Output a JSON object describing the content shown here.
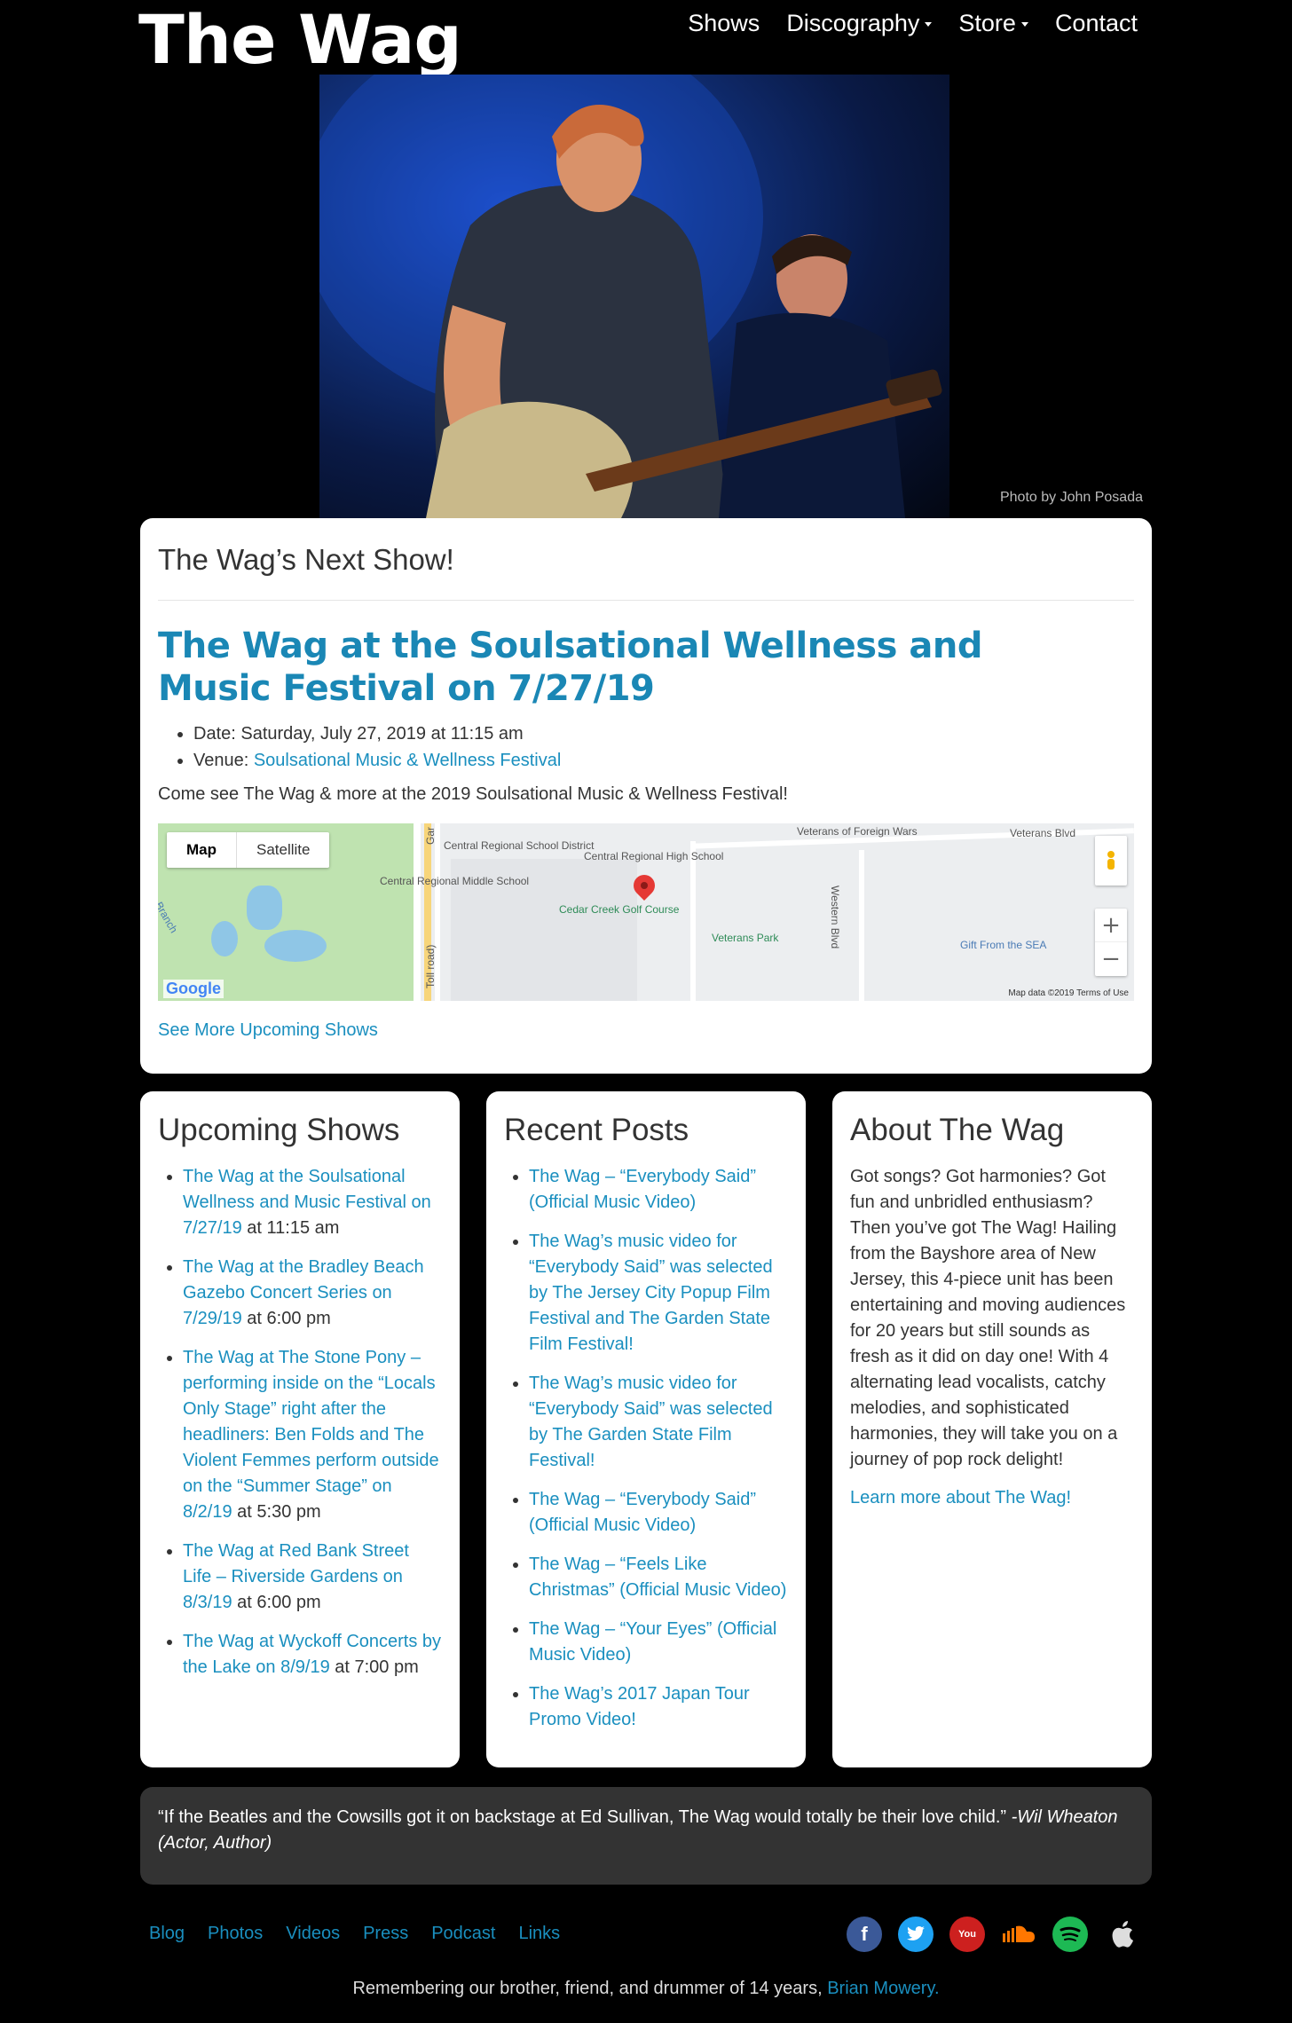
{
  "header": {
    "logo": "The Wag",
    "nav": [
      {
        "label": "Shows",
        "has_dropdown": false
      },
      {
        "label": "Discography",
        "has_dropdown": true
      },
      {
        "label": "Store",
        "has_dropdown": true
      },
      {
        "label": "Contact",
        "has_dropdown": false
      }
    ]
  },
  "hero": {
    "photo_credit": "Photo by John Posada"
  },
  "next_show": {
    "heading": "The Wag’s Next Show!",
    "event_title": "The Wag at the Soulsational Wellness and Music Festival on 7/27/19",
    "date_text": "Date: Saturday, July 27, 2019 at 11:15 am",
    "venue_label": "Venue: ",
    "venue_link": "Soulsational Music & Wellness Festival",
    "description": "Come see The Wag & more at the 2019 Soulsational Music & Wellness Festival!",
    "see_more": "See More Upcoming Shows",
    "map": {
      "toggle_map": "Map",
      "toggle_satellite": "Satellite",
      "labels": {
        "veterans_foreign_wars": "Veterans of Foreign Wars",
        "veterans_blvd": "Veterans Blvd",
        "central_regional_school_district": "Central Regional School District",
        "central_regional_high_school": "Central Regional High School",
        "central_regional_middle_school": "Central Regional Middle School",
        "cedar_creek": "Cedar Creek Golf Course",
        "veterans_park": "Veterans Park",
        "western_blvd": "Western Blvd",
        "gift_from_the_sea": "Gift From the SEA",
        "branch": "Branch",
        "toll_road": "Toll road)",
        "garden": "Gar"
      },
      "google_logo": "Google",
      "attribution": "Map data ©2019   Terms of Use"
    }
  },
  "upcoming_shows": {
    "heading": "Upcoming Shows",
    "items": [
      {
        "link": "The Wag at the Soulsational Wellness and Music Festival on 7/27/19",
        "time": " at 11:15 am"
      },
      {
        "link": "The Wag at the Bradley Beach Gazebo Concert Series on 7/29/19",
        "time": " at 6:00 pm"
      },
      {
        "link": "The Wag at The Stone Pony – performing inside on the “Locals Only Stage” right after the headliners: Ben Folds and The Violent Femmes perform outside on the “Summer Stage” on 8/2/19",
        "time": " at 5:30 pm"
      },
      {
        "link": "The Wag at Red Bank Street Life – Riverside Gardens on 8/3/19",
        "time": " at 6:00 pm"
      },
      {
        "link": "The Wag at Wyckoff Concerts by the Lake on 8/9/19",
        "time": " at 7:00 pm"
      }
    ]
  },
  "recent_posts": {
    "heading": "Recent Posts",
    "items": [
      "The Wag – “Everybody Said” (Official Music Video)",
      "The Wag’s music video for “Everybody Said” was selected by The Jersey City Popup Film Festival and The Garden State Film Festival!",
      "The Wag’s music video for “Everybody Said” was selected by The Garden State Film Festival!",
      "The Wag – “Everybody Said” (Official Music Video)",
      "The Wag – “Feels Like Christmas” (Official Music Video)",
      "The Wag – “Your Eyes” (Official Music Video)",
      "The Wag’s 2017 Japan Tour Promo Video!"
    ]
  },
  "about": {
    "heading": "About The Wag",
    "body": "Got songs? Got harmonies? Got fun and unbridled enthusiasm? Then you’ve got The Wag! Hailing from the Bayshore area of New Jersey, this 4-piece unit has been entertaining and moving audiences for 20 years but still sounds as fresh as it did on day one! With 4 alternating lead vocalists, catchy melodies, and sophisticated harmonies, they will take you on a journey of pop rock delight!",
    "link": "Learn more about The Wag!"
  },
  "quote": {
    "text": "“If the Beatles and the Cowsills got it on backstage at Ed Sullivan, The Wag would totally be their love child.”",
    "attribution": " -Wil Wheaton (Actor, Author)"
  },
  "footer": {
    "links": [
      "Blog",
      "Photos",
      "Videos",
      "Press",
      "Podcast",
      "Links"
    ],
    "socials": [
      {
        "name": "facebook-icon",
        "glyph": "f",
        "color": "#3b5998"
      },
      {
        "name": "twitter-icon",
        "glyph": "t",
        "color": "#1da1f2"
      },
      {
        "name": "youtube-icon",
        "glyph": "You",
        "color": "#cd201f"
      },
      {
        "name": "soundcloud-icon",
        "glyph": "",
        "color": "#ff7700"
      },
      {
        "name": "spotify-icon",
        "glyph": "",
        "color": "#1db954"
      },
      {
        "name": "apple-icon",
        "glyph": "",
        "color": "#dddddd"
      }
    ],
    "remember_text": "Remembering our brother, friend, and drummer of 14 years, ",
    "remember_link": "Brian Mowery."
  },
  "colors": {
    "link": "#1a8fbf",
    "background": "#000000",
    "card": "#ffffff",
    "quote_bg": "#333333"
  }
}
